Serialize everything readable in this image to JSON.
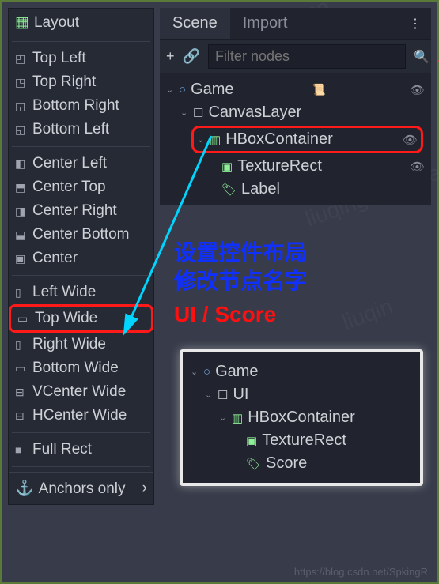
{
  "layout_menu": {
    "title": "Layout",
    "items_group1": [
      "Top Left",
      "Top Right",
      "Bottom Right",
      "Bottom Left"
    ],
    "items_group2": [
      "Center Left",
      "Center Top",
      "Center Right",
      "Center Bottom",
      "Center"
    ],
    "items_group3": [
      "Left Wide",
      "Top Wide",
      "Right Wide",
      "Bottom Wide",
      "VCenter Wide",
      "HCenter Wide"
    ],
    "items_group4": [
      "Full Rect"
    ],
    "footer": "Anchors only",
    "highlighted": "Top Wide"
  },
  "scene": {
    "tabs": {
      "scene": "Scene",
      "import": "Import"
    },
    "filter_placeholder": "Filter nodes",
    "tree1": {
      "root": "Game",
      "nodes": [
        "CanvasLayer",
        "HBoxContainer",
        "TextureRect",
        "Label"
      ],
      "highlighted": "HBoxContainer"
    },
    "tree2": {
      "root": "Game",
      "nodes": [
        "UI",
        "HBoxContainer",
        "TextureRect",
        "Score"
      ]
    }
  },
  "annotations": {
    "line1": "设置控件布局",
    "line2": "修改节点名字",
    "line3": "UI / Score"
  },
  "watermark": "https://blog.csdn.net/SpkingR"
}
